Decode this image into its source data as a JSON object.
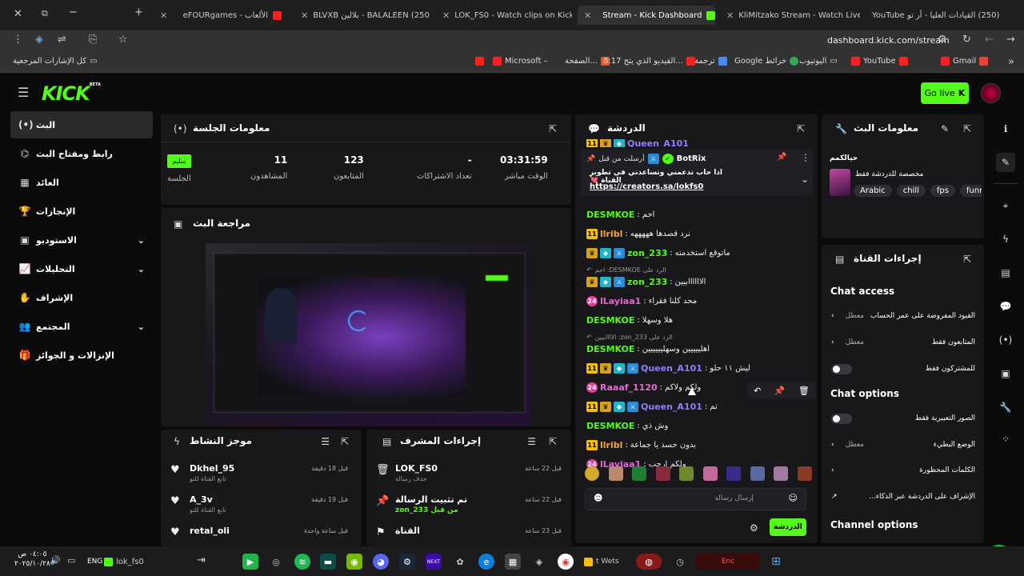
{
  "browser": {
    "tabs": [
      {
        "label": "eFOURgames - الألعاب",
        "type": "y"
      },
      {
        "label": "(250) BALALEEN - بلالين BLVXB",
        "type": "y"
      },
      {
        "label": "LOK_FS0 - Watch clips on Kick",
        "type": "k"
      },
      {
        "label": "Stream - Kick Dashboard",
        "type": "k"
      },
      {
        "label": "KliMitzako Stream - Watch Live",
        "type": "k"
      },
      {
        "label": "(250) القيادات العليا - أر تو YouTube",
        "type": "y"
      }
    ],
    "url": "dashboard.kick.com/stream",
    "bookmarks": [
      "كل الإشارات المرجعية",
      "Microsoft –",
      "الصفحة...",
      "8:17 الفيديو الذي يتج...",
      "ترجمة",
      "Google خرائط",
      "اليوتيوب",
      "YouTube",
      "Gmail"
    ]
  },
  "app": {
    "logo": "KICK",
    "logo_sup": "BETA",
    "go_live": "Go live"
  },
  "sidebar": [
    {
      "label": "البث",
      "icon": "(•)"
    },
    {
      "label": "رابط ومفتاح البث",
      "icon": "⌬"
    },
    {
      "label": "العائد",
      "icon": "▦"
    },
    {
      "label": "الإنجازات",
      "icon": "🏆"
    },
    {
      "label": "الاستوديو",
      "icon": "▣"
    },
    {
      "label": "التحليلات",
      "icon": "📈"
    },
    {
      "label": "الإشراف",
      "icon": "✋"
    },
    {
      "label": "المجتمع",
      "icon": "👥"
    },
    {
      "label": "الإنزالات و الجوائز",
      "icon": "🎁"
    }
  ],
  "session": {
    "title": "معلومات الجلسة",
    "stats": [
      {
        "value": "03:31:59",
        "label": "الوقت مباشر"
      },
      {
        "value": "-",
        "label": "تعداد الاشتراكات"
      },
      {
        "value": "123",
        "label": "المتابعون"
      },
      {
        "value": "11",
        "label": "المشاهدون"
      },
      {
        "value": "سليم",
        "label": "الجلسة"
      }
    ]
  },
  "preview": {
    "title": "مراجعة البث"
  },
  "activity": {
    "title": "موجز النشاط",
    "items": [
      {
        "name": "Dkhel_95",
        "sub": "تابع القناة للتو",
        "time": "قبل 18 دقيقة"
      },
      {
        "name": "A_3v",
        "sub": "تابع القناة للتو",
        "time": "قبل 19 دقيقة"
      },
      {
        "name": "retal_oli",
        "sub": "",
        "time": "قبل ساعة واحدة"
      }
    ]
  },
  "modactions": {
    "title": "إجراءات المشرف",
    "items": [
      {
        "name": "LOK_FS0",
        "sub": "حذف رسالة",
        "time": "قبل 22 ساعة"
      },
      {
        "name": "تم تثبيت الرسالة",
        "sub": "من قبل zon_233",
        "time": "قبل 22 ساعة"
      },
      {
        "name": "القناة",
        "sub": "",
        "time": "قبل 23 ساعة"
      }
    ]
  },
  "chat": {
    "title": "الدردشة",
    "pinned_by": "أرسلت من قبل",
    "pinned_user": "BotRix",
    "pinned_text": "اذا حاب تدعمني وتساعدني في تطوير القناة 💘",
    "pinned_link": "https://creators.sa/lokfs0",
    "top_partial_user": "Queen_A101",
    "messages": [
      {
        "user": "DESMKOE",
        "color": "#53fc18",
        "text": "احم",
        "badges": []
      },
      {
        "user": "llribl",
        "color": "#f0a83a",
        "text": "نرد قصدها هههههه",
        "badges": [
          "gold"
        ]
      },
      {
        "user": "zon_233",
        "color": "#53fc18",
        "text": "ماتوقع استخدمته",
        "badges": [
          "crown",
          "teal",
          "blue"
        ]
      },
      {
        "user": "zon_233",
        "color": "#53fc18",
        "text": "الاااااابيين",
        "badges": [
          "crown",
          "teal",
          "blue"
        ],
        "reply": "الرد على DESMKOE: احم"
      },
      {
        "user": "lLayiaa1",
        "color": "#e06ad0",
        "text": "محد كلنا فقراء",
        "badges": [
          "pink"
        ]
      },
      {
        "user": "DESMKOE",
        "color": "#53fc18",
        "text": "هلا وسهلا",
        "badges": []
      },
      {
        "user": "DESMKOE",
        "color": "#53fc18",
        "text": "اهلييييين وسهليييييين",
        "badges": [],
        "reply": "الرد على zon_233: الاااابيين"
      },
      {
        "user": "Queen_A101",
        "color": "#8f7dff",
        "text": "ليش ١١ حلو",
        "badges": [
          "gold",
          "crown",
          "teal",
          "blue"
        ]
      },
      {
        "user": "Raaaf_1120",
        "color": "#e06ad0",
        "text": "ولكم ولاكم",
        "badges": [
          "pink"
        ]
      },
      {
        "user": "Queen_A101",
        "color": "#8f7dff",
        "text": "تم",
        "badges": [
          "gold",
          "crown",
          "teal",
          "blue"
        ]
      },
      {
        "user": "DESMKOE",
        "color": "#53fc18",
        "text": "وش ذي",
        "badges": []
      },
      {
        "user": "llribl",
        "color": "#f0a83a",
        "text": "بدون حسد يا جماعة",
        "badges": [
          "gold"
        ]
      },
      {
        "user": "lLayiaa1",
        "color": "#e06ad0",
        "text": "ولكم ارحب",
        "badges": [
          "pink"
        ]
      }
    ],
    "placeholder": "إرسال رسالة",
    "send": "الدردشة"
  },
  "streaminfo": {
    "title": "معلومات البث",
    "stream_title": "حيالكمم",
    "subtitle": "مخصصة للدردشة فقط",
    "tags": [
      "Arabic",
      "chill",
      "fps",
      "funn"
    ]
  },
  "channel": {
    "title": "إجراءات القناة",
    "chat_access": "Chat access",
    "access_rows": [
      {
        "label": "القيود المفروضة على عمر الحساب",
        "state": "معطل",
        "kind": "arrow"
      },
      {
        "label": "المتابعون فقط",
        "state": "معطل",
        "kind": "arrow"
      },
      {
        "label": "للمشتركون فقط",
        "state": "",
        "kind": "toggle"
      }
    ],
    "chat_options": "Chat options",
    "option_rows": [
      {
        "label": "الصور التعبيرية فقط",
        "state": "",
        "kind": "toggle"
      },
      {
        "label": "الوضع البطيء",
        "state": "معطل",
        "kind": "arrow"
      },
      {
        "label": "الكلمات المحظورة",
        "state": "",
        "kind": "arrow"
      },
      {
        "label": "الإشراف على الدردشة عبر الذكاء...",
        "state": "",
        "kind": "ext"
      }
    ],
    "channel_options": "Channel options"
  },
  "taskbar": {
    "lang": "ENG",
    "time": "٠٤:٠٥ ص",
    "date": "٢٠٢٥/١٠/٢٨",
    "kick_label": "lok_fs0",
    "weather": "t Wets",
    "app_red": "Enc"
  }
}
